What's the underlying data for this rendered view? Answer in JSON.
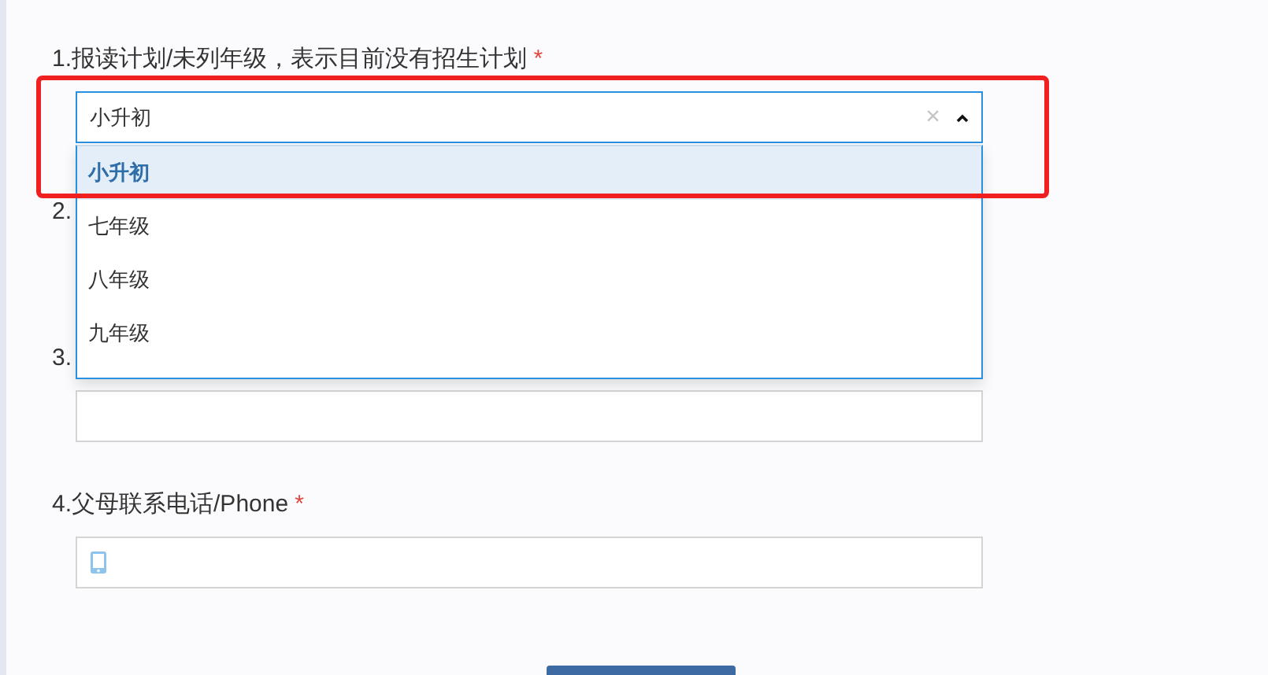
{
  "questions": [
    {
      "number": "1.",
      "label": "报读计划/未列年级，表示目前没有招生计划",
      "required_mark": "*",
      "kind": "select",
      "value": "小升初",
      "expanded": true,
      "clear": "×",
      "options": [
        {
          "label": "小升初",
          "selected": true
        },
        {
          "label": "七年级",
          "selected": false
        },
        {
          "label": "八年级",
          "selected": false
        },
        {
          "label": "九年级",
          "selected": false
        }
      ]
    },
    {
      "number": "2.",
      "kind": "hidden"
    },
    {
      "number": "3.",
      "kind": "text"
    },
    {
      "number": "4.",
      "label": "父母联系电话/Phone",
      "required_mark": "*",
      "kind": "phone"
    }
  ],
  "highlight": {
    "shown": true
  }
}
